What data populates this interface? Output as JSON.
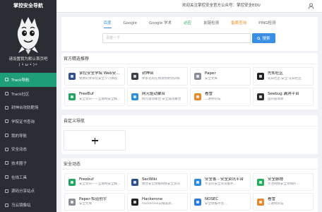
{
  "sidebar": {
    "title": "掌控安全导航",
    "logo_icon": "mascot-logo",
    "tagline": "请设置我为默认首页吧",
    "emoticon": "( •̀ ω •́ )✧",
    "active_color": "#1e9f7a",
    "menu": [
      {
        "label": "Track导航",
        "icon": "compass-icon",
        "active": true
      },
      {
        "label": "Track社区",
        "icon": "community-icon"
      },
      {
        "label": "封神台攻防靶场",
        "icon": "target-icon"
      },
      {
        "label": "学院证书查询",
        "icon": "certificate-icon"
      },
      {
        "label": "我的导航",
        "icon": "bookmark-icon"
      },
      {
        "label": "安全动态",
        "icon": "news-icon"
      },
      {
        "label": "技术圈子",
        "icon": "circle-icon"
      },
      {
        "label": "在线工具",
        "icon": "tool-icon"
      },
      {
        "label": "源码分享站点",
        "icon": "code-icon"
      },
      {
        "label": "乌云镜像站",
        "icon": "cloud-icon"
      }
    ]
  },
  "header": {
    "notice": "欢迎关注掌控安全官方公众号：掌控安全EDU",
    "user_icon": "user-icon"
  },
  "search": {
    "tabs": [
      {
        "label": "百度",
        "color": "#3a8ee6",
        "active": true
      },
      {
        "label": "Google",
        "color": "#666666"
      },
      {
        "label": "Google 学术",
        "color": "#666666"
      },
      {
        "label": "必应",
        "color": "#27a35a"
      },
      {
        "label": "友链检测",
        "color": "#666666"
      },
      {
        "label": "备案查询",
        "color": "#f0912f"
      },
      {
        "label": "PING检测",
        "color": "#666666"
      }
    ],
    "placeholder": "百度一下",
    "button_label": "搜索",
    "button_icon": "search-icon",
    "button_color": "#3a8ee6"
  },
  "official": {
    "title": "官方精选推荐",
    "items": [
      {
        "title": "掌控安全学院 Web安全...",
        "desc": "免费的体系化安全学习课程",
        "icon": "zkaq-academy-icon",
        "icon_color": "#2f4f8f"
      },
      {
        "title": "封神台",
        "desc": "体系化的在线攻防靶场训练",
        "icon": "fengshentai-icon",
        "icon_color": "#3b3f46"
      },
      {
        "title": "Paper",
        "desc": "安全文库",
        "icon": "paper-icon",
        "icon_color": "#8a8f98"
      },
      {
        "title": "先知社区",
        "desc": "先知社区·安全·先知社区",
        "icon": "xianzhi-icon",
        "icon_color": "#202124"
      },
      {
        "title": "FreeBuf",
        "desc": "安全资讯——互联网安全媒...",
        "icon": "freebuf-icon",
        "icon_color": "#1fa463"
      },
      {
        "title": "网元驱动聚合",
        "desc": "网元驱动聚合 安全漏洞聚合",
        "icon": "aggregator-icon",
        "icon_color": "#2f8fdc"
      },
      {
        "title": "看雪",
        "desc": "二进制论坛",
        "icon": "kanxue-icon",
        "icon_color": "#e58a2c"
      },
      {
        "title": "Seebug 漏洞平台",
        "desc": "国内漏洞库",
        "icon": "seebug-icon",
        "icon_color": "#2b2b2b"
      }
    ]
  },
  "custom": {
    "title": "自定义导航",
    "add_icon": "plus-icon"
  },
  "news": {
    "title": "安全动态",
    "items": [
      {
        "title": "Freebuf",
        "desc": "安全资讯——互联网安全媒体...",
        "icon": "freebuf-icon",
        "icon_color": "#1fa463"
      },
      {
        "title": "SecWiki",
        "desc": "整合安全依据网络安全资讯",
        "icon": "secwiki-icon",
        "icon_color": "#2d4f8a"
      },
      {
        "title": "安全客 - 安全资讯平台",
        "desc": "专业的安全资讯服务...",
        "icon": "anquanke-icon",
        "icon_color": "#2c8de0"
      },
      {
        "title": "安全脉搏",
        "desc": "专注网络安全领域的...",
        "icon": "secpulse-icon",
        "icon_color": "#27ae60"
      },
      {
        "title": "Paper-知道创宇",
        "desc": "安全文库",
        "icon": "paper-icon",
        "icon_color": "#8a8f98"
      },
      {
        "title": "Hackerone",
        "desc": "hackerone白帽漏洞...",
        "icon": "hackerone-icon",
        "icon_color": "#222222"
      },
      {
        "title": "NOSEC",
        "desc": "安全情报平台...",
        "icon": "nosec-icon",
        "icon_color": "#2a7be4"
      },
      {
        "title": "看雪",
        "desc": "二进制论坛",
        "icon": "kanxue-icon",
        "icon_color": "#e58a2c"
      }
    ]
  }
}
